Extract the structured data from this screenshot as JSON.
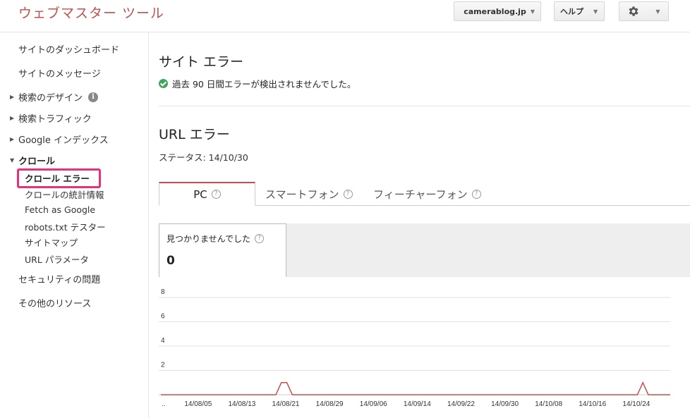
{
  "header": {
    "app_title": "ウェブマスター ツール",
    "site_selector_label": "camerablog.jp",
    "help_label": "ヘルプ",
    "camera_icon": "camera-icon",
    "settings_icon": "gear-icon"
  },
  "sidebar": {
    "items": [
      {
        "label": "サイトのダッシュボード"
      },
      {
        "label": "サイトのメッセージ"
      },
      {
        "label": "検索のデザイン",
        "info": "i"
      },
      {
        "label": "検索トラフィック"
      },
      {
        "label": "Google インデックス"
      },
      {
        "label": "クロール"
      },
      {
        "label": "クロール エラー",
        "selected": true
      },
      {
        "label": "クロールの統計情報"
      },
      {
        "label": "Fetch as Google"
      },
      {
        "label": "robots.txt テスター"
      },
      {
        "label": "サイトマップ"
      },
      {
        "label": "URL パラメータ"
      },
      {
        "label": "セキュリティの問題"
      },
      {
        "label": "その他のリソース"
      }
    ]
  },
  "main": {
    "site_errors_title": "サイト エラー",
    "site_errors_message": "過去 90 日間エラーが検出されませんでした。",
    "url_errors_title": "URL エラー",
    "status": "ステータス: 14/10/30",
    "tabs": [
      {
        "label": "PC",
        "help": "?"
      },
      {
        "label": "スマートフォン",
        "help": "?"
      },
      {
        "label": "フィーチャーフォン",
        "help": "?"
      }
    ],
    "card": {
      "label": "見つかりませんでした",
      "help": "?",
      "value": "0"
    }
  },
  "chart_data": {
    "type": "line",
    "y_ticks": [
      "8",
      "6",
      "4",
      "2"
    ],
    "ylim": [
      0,
      8
    ],
    "x_tick_labels": [
      "..",
      "14/08/05",
      "14/08/13",
      "14/08/21",
      "14/08/29",
      "14/09/06",
      "14/09/14",
      "14/09/22",
      "14/09/30",
      "14/10/08",
      "14/10/16",
      "14/10/24"
    ],
    "series": [
      {
        "color": "#c0504d",
        "points": [
          {
            "x": "14/07/29",
            "y": 0
          },
          {
            "x": "14/08/19",
            "y": 0
          },
          {
            "x": "14/08/20",
            "y": 1
          },
          {
            "x": "14/08/21",
            "y": 1
          },
          {
            "x": "14/08/22",
            "y": 0
          },
          {
            "x": "14/10/24",
            "y": 0
          },
          {
            "x": "14/10/25",
            "y": 1
          },
          {
            "x": "14/10/26",
            "y": 0
          },
          {
            "x": "14/10/30",
            "y": 0
          }
        ]
      }
    ]
  }
}
